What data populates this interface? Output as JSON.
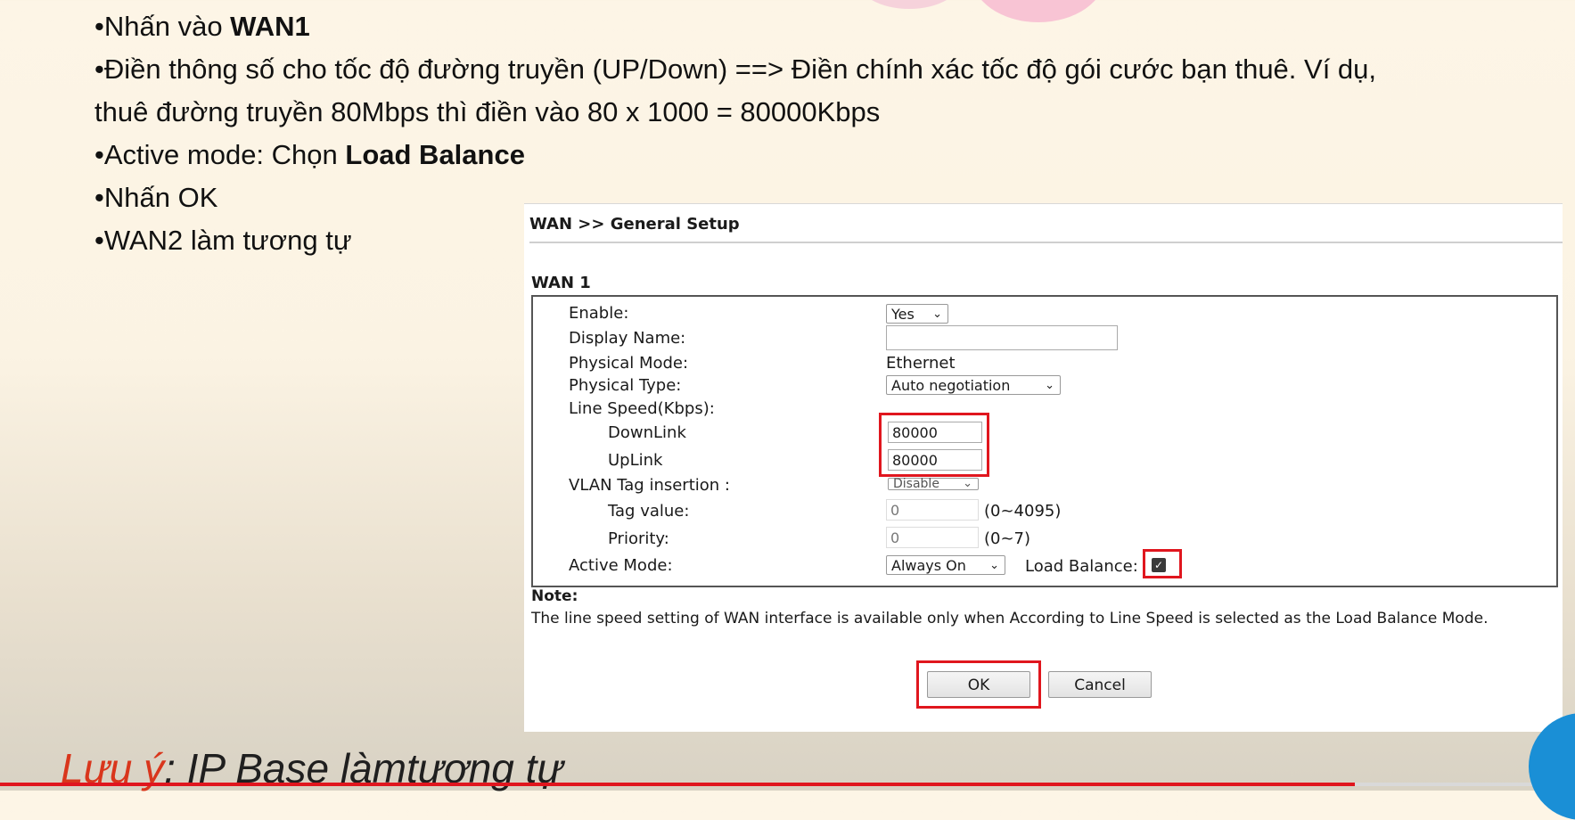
{
  "slide": {
    "bullet1_prefix": "•Nhấn vào ",
    "bullet1_bold": "WAN1",
    "bullet2_line1": "•Điền thông số cho tốc độ đường truyền (UP/Down) ==> Điền chính xác tốc độ gói cước bạn thuê. Ví dụ,",
    "bullet2_line2": "thuê đường truyền 80Mbps thì điền vào 80 x 1000 = 80000Kbps",
    "bullet3_prefix": "•Active mode: Chọn ",
    "bullet3_bold": "Load Balance",
    "bullet4": "•Nhấn OK",
    "bullet5": "•WAN2 làm tương tự",
    "footer_accent": "Lưu ý",
    "footer_rest": ": IP Base làmtương tự"
  },
  "router": {
    "breadcrumb": "WAN >> General Setup",
    "section_title": "WAN 1",
    "enable_label": "Enable:",
    "enable_value": "Yes",
    "display_name_label": "Display Name:",
    "display_name_value": "",
    "physical_mode_label": "Physical Mode:",
    "physical_mode_value": "Ethernet",
    "physical_type_label": "Physical Type:",
    "physical_type_value": "Auto negotiation",
    "line_speed_label": "Line Speed(Kbps):",
    "downlink_label": "DownLink",
    "downlink_value": "80000",
    "uplink_label": "UpLink",
    "uplink_value": "80000",
    "vlan_label": "VLAN Tag insertion :",
    "vlan_value": "Disable",
    "tag_value_label": "Tag value:",
    "tag_value": "0",
    "tag_range": "(0~4095)",
    "priority_label": "Priority:",
    "priority_value": "0",
    "priority_range": "(0~7)",
    "active_mode_label": "Active Mode:",
    "active_mode_value": "Always On",
    "load_balance_label": "Load Balance:",
    "load_balance_checked": true,
    "note_title": "Note:",
    "note_text": "The line speed setting of WAN interface is available only when According to Line Speed is selected as the Load Balance Mode.",
    "ok_label": "OK",
    "cancel_label": "Cancel"
  },
  "colors": {
    "highlight": "#e0161e",
    "accent_text": "#d9361c"
  }
}
